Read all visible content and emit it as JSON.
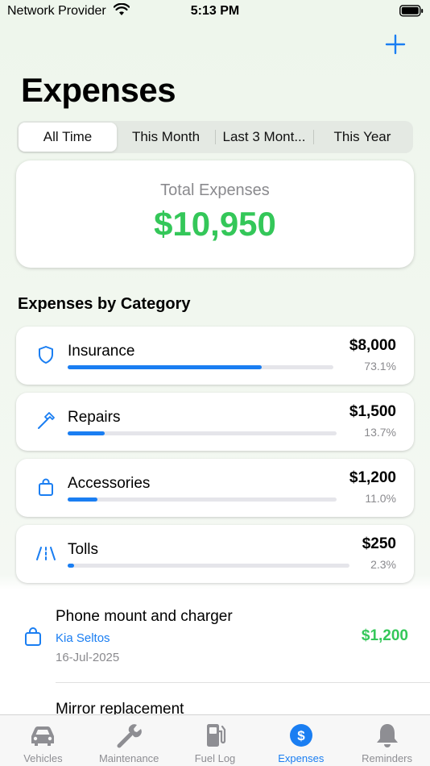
{
  "status_bar": {
    "carrier": "Network Provider",
    "time": "5:13 PM"
  },
  "header": {
    "title": "Expenses",
    "add_icon": "plus-icon"
  },
  "filters": {
    "options": [
      "All Time",
      "This Month",
      "Last 3 Mont...",
      "This Year"
    ],
    "selected": "All Time"
  },
  "summary": {
    "label": "Total Expenses",
    "amount": "$10,950"
  },
  "categories": {
    "title": "Expenses by Category",
    "items": [
      {
        "name": "Insurance",
        "amount": "$8,000",
        "percent": "73.1%",
        "fraction": 0.731,
        "icon": "shield-icon"
      },
      {
        "name": "Repairs",
        "amount": "$1,500",
        "percent": "13.7%",
        "fraction": 0.137,
        "icon": "hammer-icon"
      },
      {
        "name": "Accessories",
        "amount": "$1,200",
        "percent": "11.0%",
        "fraction": 0.11,
        "icon": "bag-icon"
      },
      {
        "name": "Tolls",
        "amount": "$250",
        "percent": "2.3%",
        "fraction": 0.023,
        "icon": "road-icon"
      }
    ]
  },
  "expenses": [
    {
      "title": "Phone mount and charger",
      "vehicle": "Kia Seltos",
      "date": "16-Jul-2025",
      "amount": "$1,200",
      "icon": "bag-icon"
    },
    {
      "title": "Mirror replacement",
      "vehicle": "",
      "date": "",
      "amount": "",
      "icon": ""
    }
  ],
  "tabs": [
    {
      "label": "Vehicles",
      "icon": "car-icon",
      "active": false
    },
    {
      "label": "Maintenance",
      "icon": "wrench-icon",
      "active": false
    },
    {
      "label": "Fuel Log",
      "icon": "fuel-pump-icon",
      "active": false
    },
    {
      "label": "Expenses",
      "icon": "dollar-circle-icon",
      "active": true
    },
    {
      "label": "Reminders",
      "icon": "bell-icon",
      "active": false
    }
  ],
  "colors": {
    "accent": "#1a7ef2",
    "money": "#34c759",
    "muted": "#8a8a8e"
  }
}
